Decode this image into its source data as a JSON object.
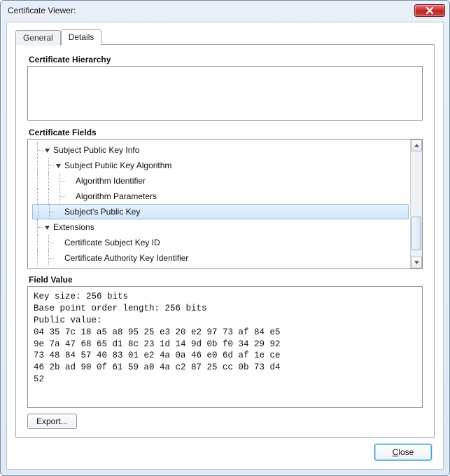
{
  "window": {
    "title": "Certificate Viewer:"
  },
  "tabs": {
    "general": "General",
    "details": "Details"
  },
  "sections": {
    "hierarchy": "Certificate Hierarchy",
    "fields": "Certificate Fields",
    "value": "Field Value"
  },
  "tree": {
    "items": [
      {
        "label": "Subject Public Key Info",
        "depth": 1,
        "expander": true
      },
      {
        "label": "Subject Public Key Algorithm",
        "depth": 2,
        "expander": true
      },
      {
        "label": "Algorithm Identifier",
        "depth": 3,
        "expander": false
      },
      {
        "label": "Algorithm Parameters",
        "depth": 3,
        "expander": false
      },
      {
        "label": "Subject's Public Key",
        "depth": 2,
        "expander": false,
        "selected": true
      },
      {
        "label": "Extensions",
        "depth": 1,
        "expander": true
      },
      {
        "label": "Certificate Subject Key ID",
        "depth": 2,
        "expander": false
      },
      {
        "label": "Certificate Authority Key Identifier",
        "depth": 2,
        "expander": false
      }
    ]
  },
  "field_value": "Key size: 256 bits\nBase point order length: 256 bits\nPublic value:\n04 35 7c 18 a5 a8 95 25 e3 20 e2 97 73 af 84 e5\n9e 7a 47 68 65 d1 8c 23 1d 14 9d 0b f0 34 29 92\n73 48 84 57 40 83 01 e2 4a 0a 46 e0 6d af 1e ce\n46 2b ad 90 0f 61 59 a0 4a c2 87 25 cc 0b 73 d4\n52",
  "buttons": {
    "export": "Export...",
    "close": "Close"
  }
}
